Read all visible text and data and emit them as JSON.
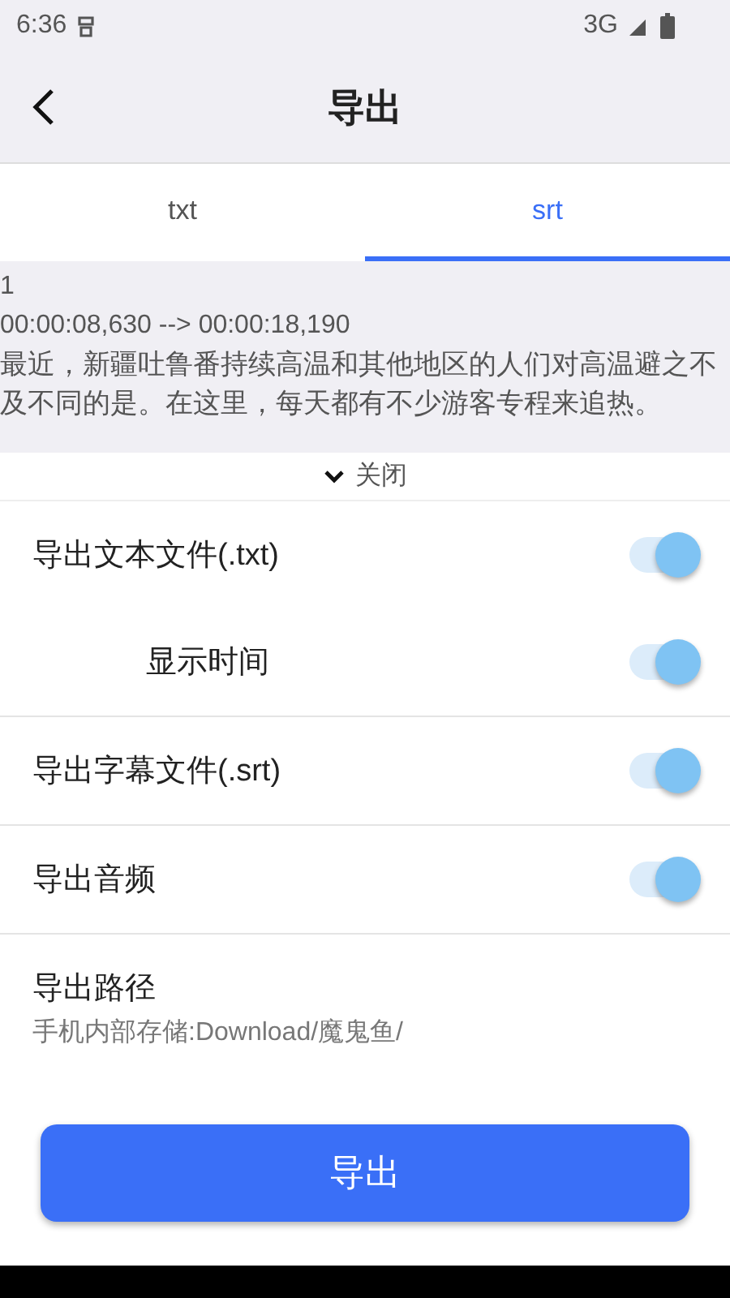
{
  "status_bar": {
    "time": "6:36",
    "network": "3G"
  },
  "header": {
    "title": "导出"
  },
  "tabs": [
    {
      "label": "txt",
      "selected": false
    },
    {
      "label": "srt",
      "selected": true
    }
  ],
  "preview": {
    "lines": [
      "1",
      "00:00:08,630 --> 00:00:18,190",
      "最近，新疆吐鲁番持续高温和其他地区的人们对高温避之不及不同的是。在这里，每天都有不少游客专程来追热。"
    ],
    "collapse_label": "关闭",
    "expanded": true
  },
  "options": [
    {
      "label": "导出文本文件(.txt)",
      "on": true,
      "children": [
        {
          "label": "显示时间",
          "on": true
        }
      ]
    },
    {
      "label": "导出字幕文件(.srt)",
      "on": true
    },
    {
      "label": "导出音频",
      "on": true
    }
  ],
  "export_path": {
    "label": "导出路径",
    "value": "手机内部存储:Download/魔鬼鱼/"
  },
  "export_button": "导出"
}
